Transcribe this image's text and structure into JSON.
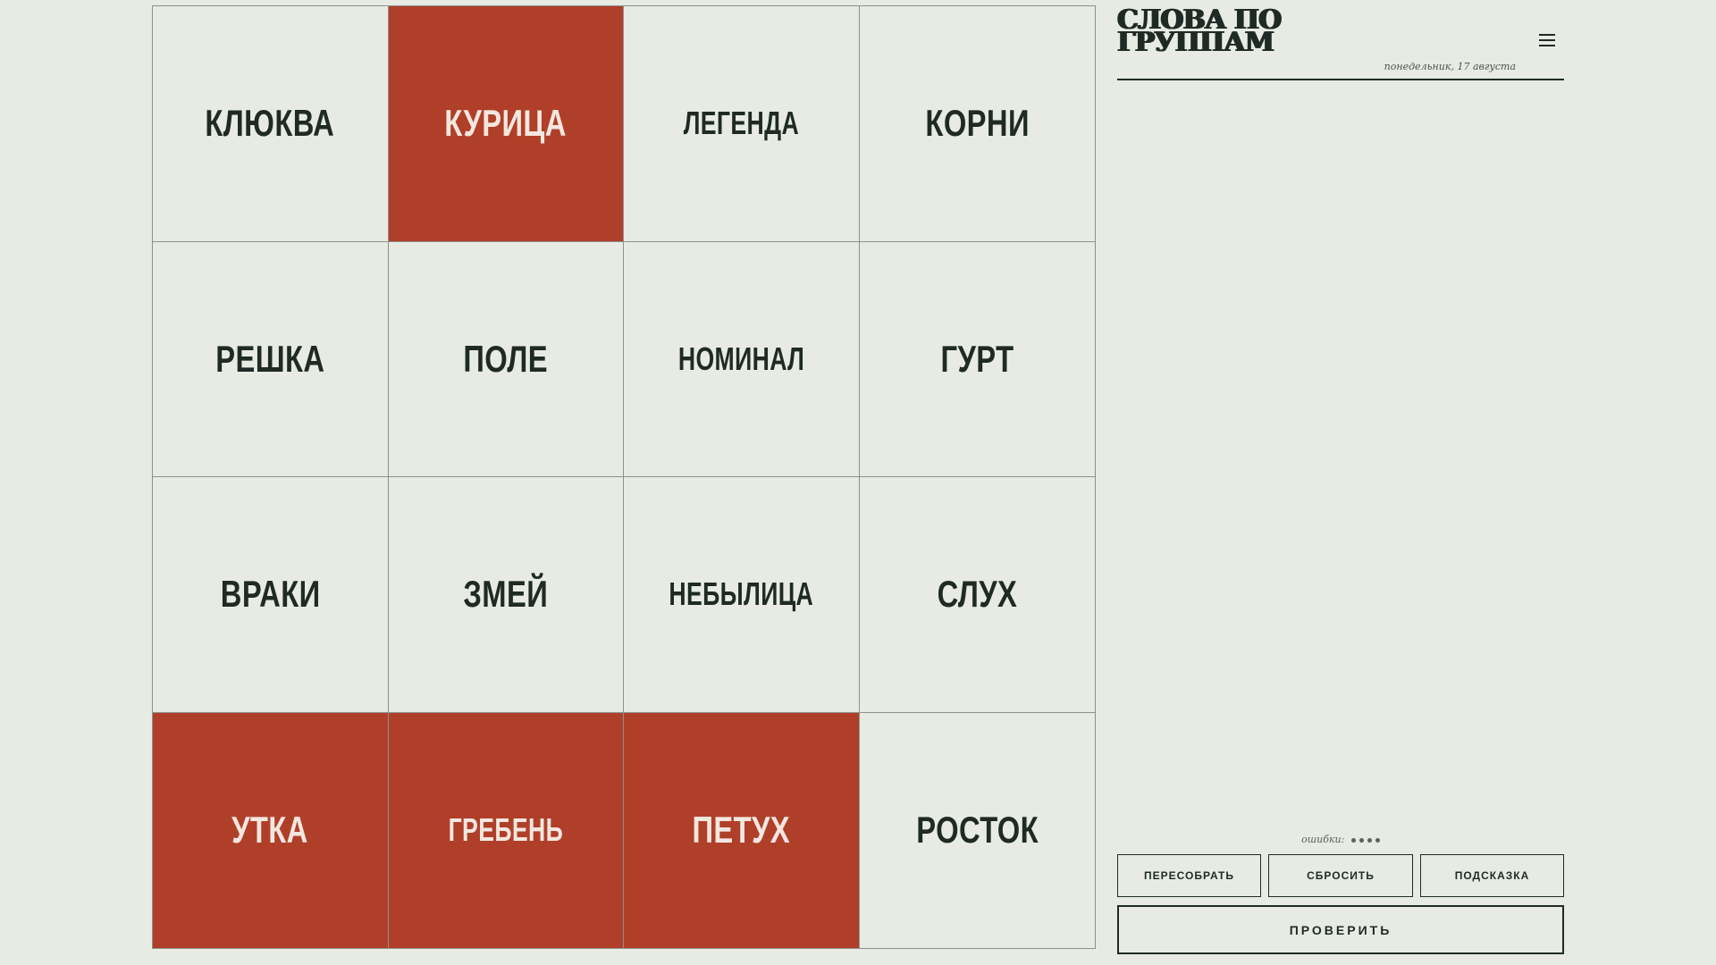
{
  "game": {
    "title_line1": "СЛОВА ПО",
    "title_line2": "ГРУППАМ",
    "date": "понедельник, 17 августа"
  },
  "board": {
    "tiles": [
      {
        "word": "КЛЮКВА",
        "selected": false
      },
      {
        "word": "КУРИЦА",
        "selected": true
      },
      {
        "word": "ЛЕГЕНДА",
        "selected": false
      },
      {
        "word": "КОРНИ",
        "selected": false
      },
      {
        "word": "РЕШКА",
        "selected": false
      },
      {
        "word": "ПОЛЕ",
        "selected": false
      },
      {
        "word": "НОМИНАЛ",
        "selected": false
      },
      {
        "word": "ГУРТ",
        "selected": false
      },
      {
        "word": "ВРАКИ",
        "selected": false
      },
      {
        "word": "ЗМЕЙ",
        "selected": false
      },
      {
        "word": "НЕБЫЛИЦА",
        "selected": false
      },
      {
        "word": "СЛУХ",
        "selected": false
      },
      {
        "word": "УТКА",
        "selected": true
      },
      {
        "word": "ГРЕБЕНЬ",
        "selected": true
      },
      {
        "word": "ПЕТУХ",
        "selected": true
      },
      {
        "word": "РОСТОК",
        "selected": false
      }
    ]
  },
  "status": {
    "mistakes_label": "ошибки:",
    "mistakes_remaining": 4
  },
  "controls": {
    "shuffle_label": "ПЕРЕСОБРАТЬ",
    "reset_label": "СБРОСИТЬ",
    "hint_label": "ПОДСКАЗКА",
    "check_label": "ПРОВЕРИТЬ"
  },
  "colors": {
    "background": "#e7ebe4",
    "selected_tile": "#b03f2a",
    "text": "#1f2a24"
  },
  "icons": {
    "menu": "hamburger-menu-icon"
  }
}
